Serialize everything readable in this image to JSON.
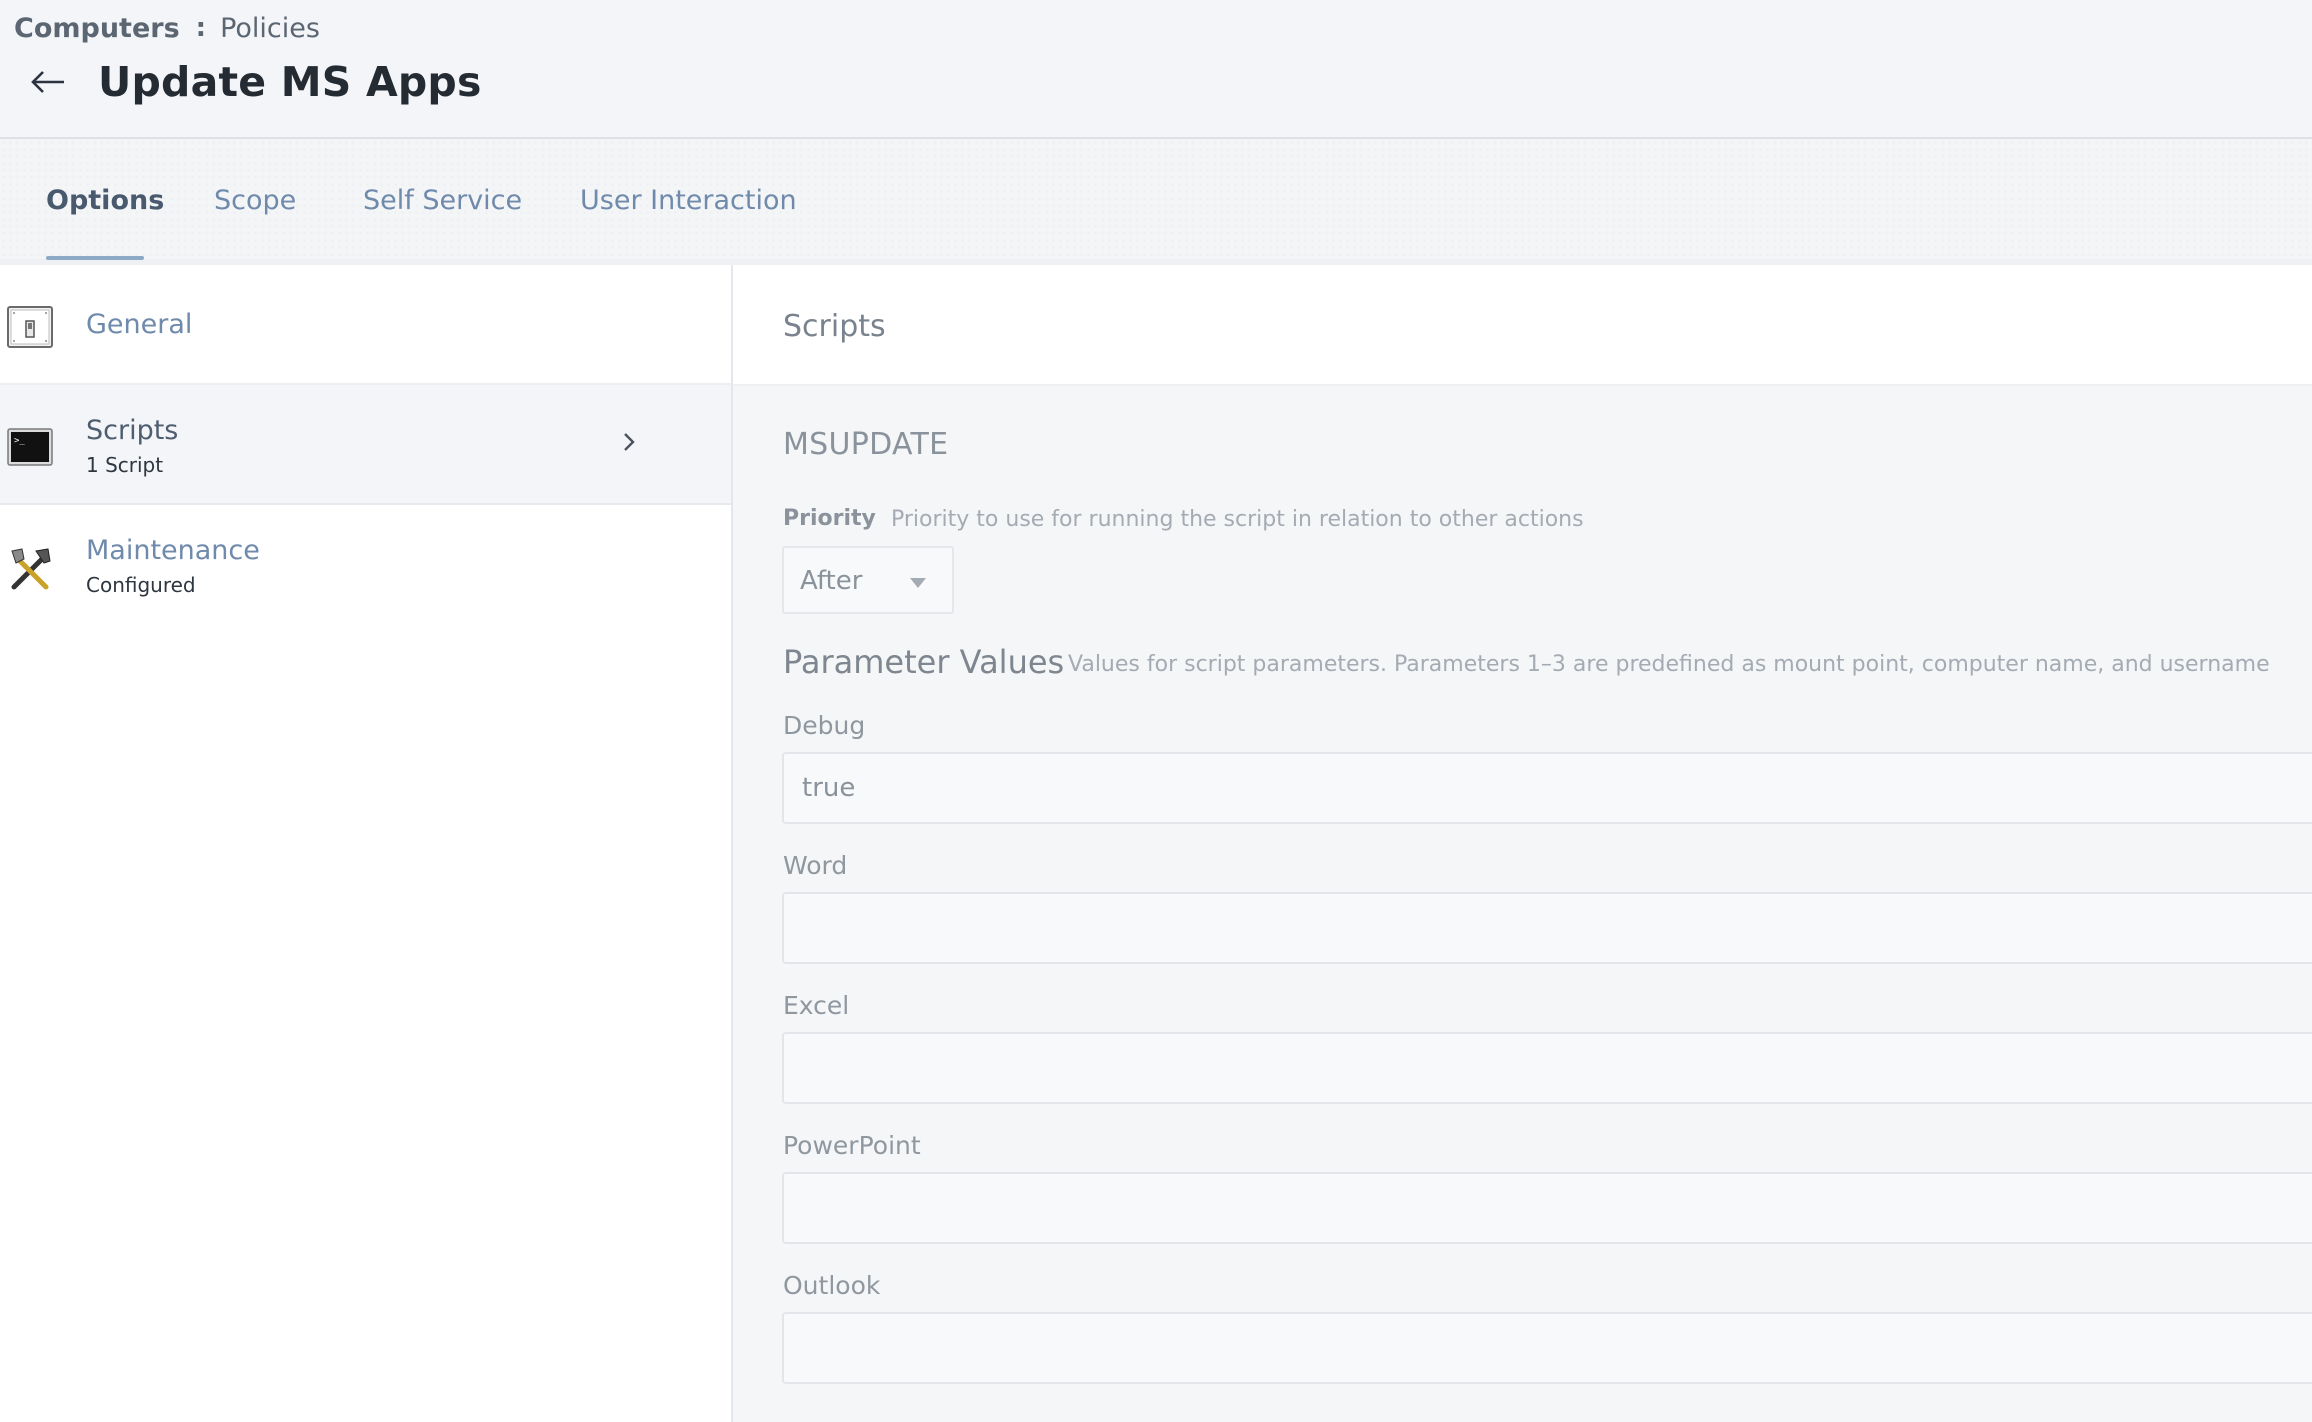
{
  "breadcrumb": {
    "root": "Computers",
    "separator": ":",
    "current": "Policies"
  },
  "page": {
    "title": "Update MS Apps",
    "back_icon": "arrow-left-icon"
  },
  "tabs": [
    {
      "label": "Options",
      "active": true
    },
    {
      "label": "Scope",
      "active": false
    },
    {
      "label": "Self Service",
      "active": false
    },
    {
      "label": "User Interaction",
      "active": false
    }
  ],
  "sidebar": {
    "items": [
      {
        "label": "General",
        "sub": "",
        "icon": "switch-icon"
      },
      {
        "label": "Scripts",
        "sub": "1 Script",
        "icon": "terminal-icon",
        "selected": true
      },
      {
        "label": "Maintenance",
        "sub": "Configured",
        "icon": "tools-icon"
      }
    ]
  },
  "main": {
    "section_title": "Scripts",
    "script_name": "MSUPDATE",
    "priority": {
      "label": "Priority",
      "description": "Priority to use for running the script in relation to other actions",
      "value": "After"
    },
    "parameters": {
      "title": "Parameter Values",
      "description": "Values for script parameters. Parameters 1–3 are predefined as mount point, computer name, and username",
      "fields": [
        {
          "label": "Debug",
          "value": "true"
        },
        {
          "label": "Word",
          "value": ""
        },
        {
          "label": "Excel",
          "value": ""
        },
        {
          "label": "PowerPoint",
          "value": ""
        },
        {
          "label": "Outlook",
          "value": ""
        }
      ]
    }
  },
  "colors": {
    "accent_link": "#6f8aab",
    "tab_underline": "#8ea9c6",
    "header_bg": "#f3f5f8"
  }
}
